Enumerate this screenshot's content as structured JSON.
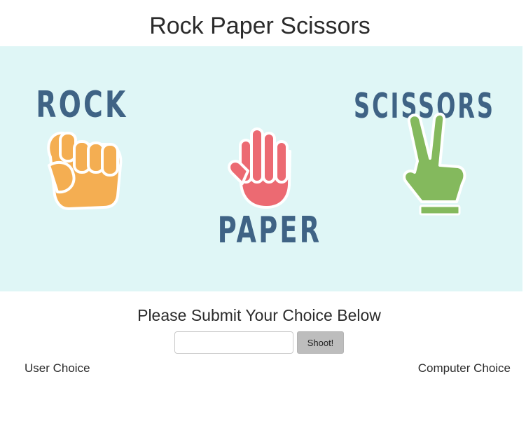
{
  "header": {
    "title": "Rock Paper Scissors"
  },
  "banner": {
    "rock_label": "ROCK",
    "paper_label": "PAPER",
    "scissors_label": "SCISSORS",
    "rock_icon": "fist-icon",
    "paper_icon": "open-hand-icon",
    "scissors_icon": "two-fingers-icon",
    "colors": {
      "background": "#dff6f6",
      "label": "#3f6385",
      "rock": "#f4ae52",
      "paper": "#ec6a72",
      "scissors": "#84b95d"
    }
  },
  "form": {
    "prompt": "Please Submit Your Choice Below",
    "input_value": "",
    "input_placeholder": "",
    "submit_label": "Shoot!"
  },
  "results": {
    "user_label": "User Choice",
    "computer_label": "Computer Choice"
  }
}
